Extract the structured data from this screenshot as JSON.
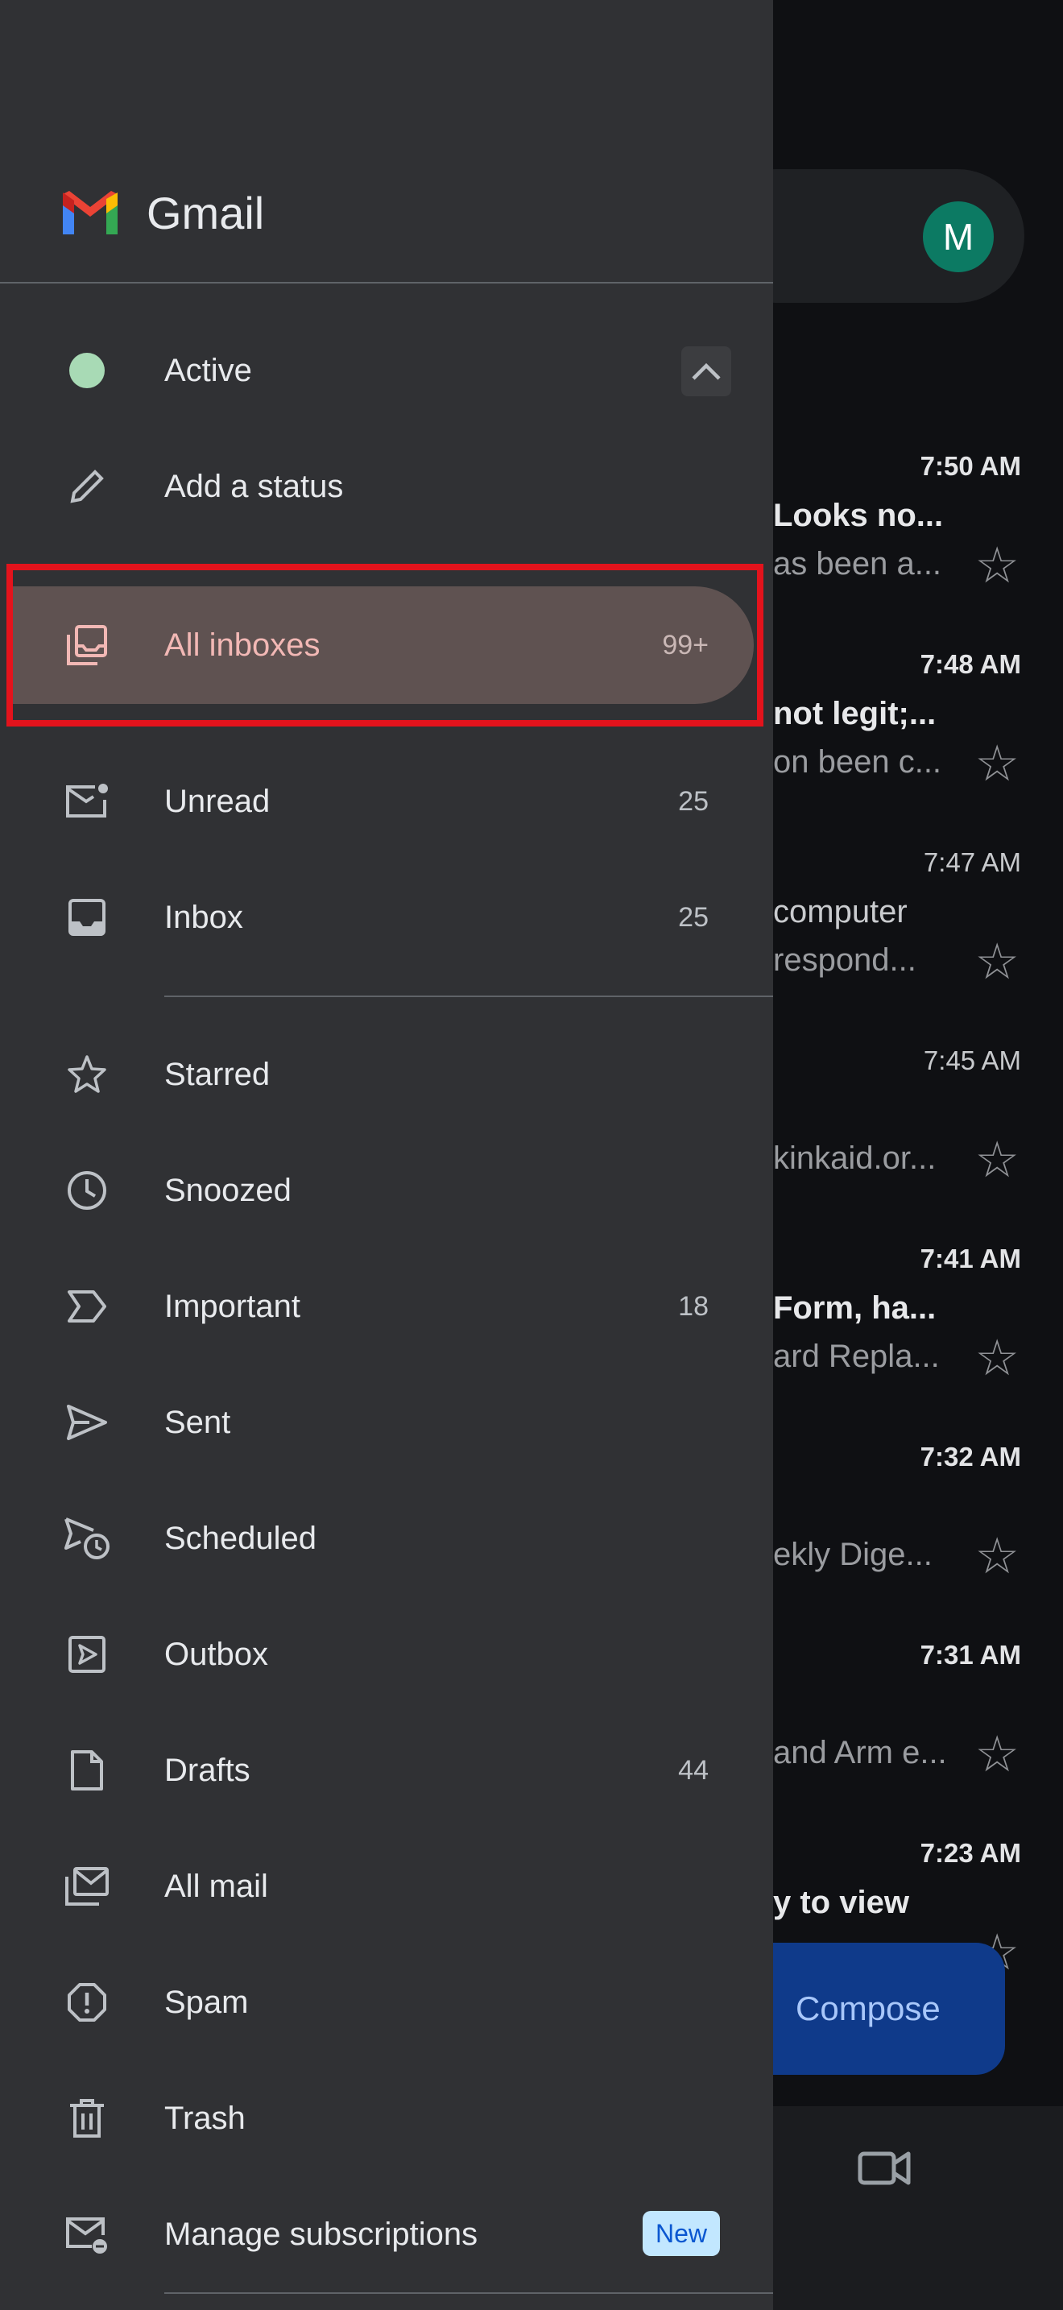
{
  "background": {
    "avatar_letter": "M",
    "emails": [
      {
        "time": "7:50 AM",
        "time_bold": true,
        "line1": "Looks no...",
        "line2": "as been a..."
      },
      {
        "time": "7:48 AM",
        "time_bold": true,
        "line1": "not legit;...",
        "line2": "on been c..."
      },
      {
        "time": "7:47 AM",
        "time_bold": false,
        "line1": "computer",
        "line2": "respond..."
      },
      {
        "time": "7:45 AM",
        "time_bold": false,
        "line1": "",
        "line2": "kinkaid.or..."
      },
      {
        "time": "7:41 AM",
        "time_bold": true,
        "line1": "Form, ha...",
        "line2": "ard Repla..."
      },
      {
        "time": "7:32 AM",
        "time_bold": true,
        "line1": "",
        "line2": "ekly Dige..."
      },
      {
        "time": "7:31 AM",
        "time_bold": true,
        "line1": "",
        "line2": "and Arm e..."
      },
      {
        "time": "7:23 AM",
        "time_bold": true,
        "line1": "y to view",
        "line2": ""
      }
    ],
    "compose_label": "Compose"
  },
  "drawer": {
    "brand": "Gmail",
    "status": {
      "label": "Active",
      "dot_color": "#a8dab5"
    },
    "add_status": "Add a status",
    "items": [
      {
        "label": "All inboxes",
        "count": "99+",
        "icon": "all-inboxes-icon",
        "selected": true
      },
      {
        "label": "Unread",
        "count": "25",
        "icon": "unread-icon"
      },
      {
        "label": "Inbox",
        "count": "25",
        "icon": "inbox-icon"
      },
      {
        "label": "Starred",
        "count": "",
        "icon": "star-icon"
      },
      {
        "label": "Snoozed",
        "count": "",
        "icon": "clock-icon"
      },
      {
        "label": "Important",
        "count": "18",
        "icon": "important-icon"
      },
      {
        "label": "Sent",
        "count": "",
        "icon": "send-icon"
      },
      {
        "label": "Scheduled",
        "count": "",
        "icon": "scheduled-icon"
      },
      {
        "label": "Outbox",
        "count": "",
        "icon": "outbox-icon"
      },
      {
        "label": "Drafts",
        "count": "44",
        "icon": "draft-icon"
      },
      {
        "label": "All mail",
        "count": "",
        "icon": "all-mail-icon"
      },
      {
        "label": "Spam",
        "count": "",
        "icon": "spam-icon"
      },
      {
        "label": "Trash",
        "count": "",
        "icon": "trash-icon"
      },
      {
        "label": "Manage subscriptions",
        "count": "",
        "icon": "manage-subscriptions-icon",
        "badge": "New"
      }
    ]
  },
  "colors": {
    "drawer_bg": "#303134",
    "selected_bg": "#5f5251",
    "selected_text": "#f2b8b5",
    "highlight_box": "#e3131c"
  }
}
